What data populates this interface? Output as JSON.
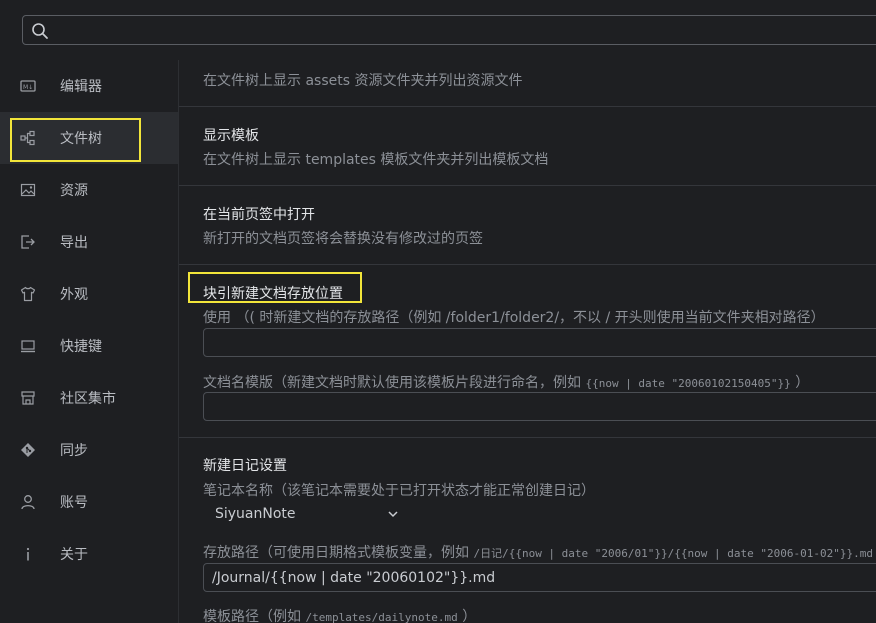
{
  "search": {
    "placeholder": "",
    "value": ""
  },
  "sidebar": {
    "items": [
      {
        "label": "编辑器",
        "icon": "editor-icon"
      },
      {
        "label": "文件树",
        "icon": "filetree-icon"
      },
      {
        "label": "资源",
        "icon": "image-icon"
      },
      {
        "label": "导出",
        "icon": "export-icon"
      },
      {
        "label": "外观",
        "icon": "shirt-icon"
      },
      {
        "label": "快捷键",
        "icon": "keyboard-icon"
      },
      {
        "label": "社区集市",
        "icon": "store-icon"
      },
      {
        "label": "同步",
        "icon": "git-icon"
      },
      {
        "label": "账号",
        "icon": "user-icon"
      },
      {
        "label": "关于",
        "icon": "info-icon"
      }
    ],
    "active_index": 1
  },
  "main": {
    "assets_desc": "在文件树上显示 assets 资源文件夹并列出资源文件",
    "templates": {
      "title": "显示模板",
      "desc": "在文件树上显示 templates 模板文件夹并列出模板文档"
    },
    "open_current_tab": {
      "title": "在当前页签中打开",
      "desc": "新打开的文档页签将会替换没有修改过的页签"
    },
    "block_ref_new_doc": {
      "title": "块引新建文档存放位置",
      "desc": "使用 （( 时新建文档的存放路径（例如 /folder1/folder2/，不以 / 开头则使用当前文件夹相对路径）",
      "path_value": "",
      "name_template_desc_prefix": "文档名模版（新建文档时默认使用该模板片段进行命名，例如",
      "name_template_example": "{{now | date \"20060102150405\"}}",
      "name_template_desc_suffix": "）",
      "name_template_value": ""
    },
    "daily_note": {
      "title": "新建日记设置",
      "notebook_desc": "笔记本名称（该笔记本需要处于已打开状态才能正常创建日记）",
      "notebook_value": "SiyuanNote",
      "save_path_desc_prefix": "存放路径（可使用日期格式模板变量，例如",
      "save_path_example": "/日记/{{now | date \"2006/01\"}}/{{now | date \"2006-01-02\"}}.md",
      "save_path_value": "/Journal/{{now | date \"20060102\"}}.md",
      "template_path_desc_prefix": "模板路径（例如",
      "template_path_example": "/templates/dailynote.md",
      "template_path_desc_suffix": "）"
    }
  },
  "highlight_color": "#f2e53a"
}
